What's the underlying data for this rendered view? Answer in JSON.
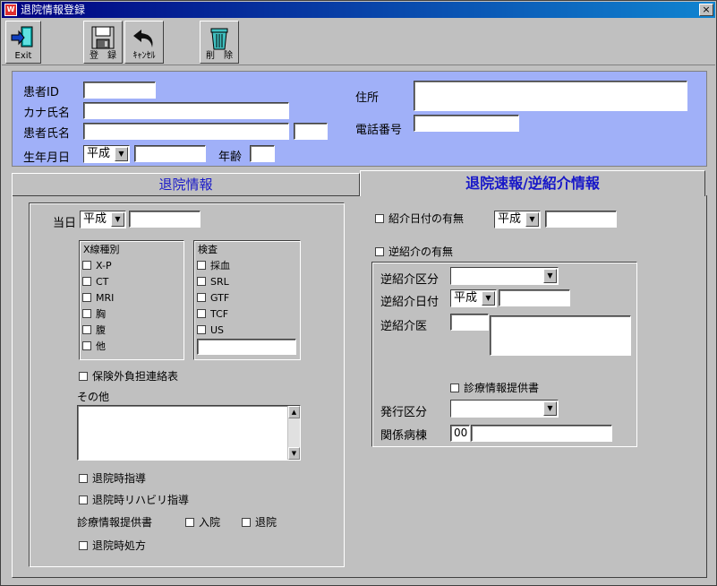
{
  "window": {
    "title": "退院情報登録",
    "icon": "app-icon",
    "close_label": "×"
  },
  "toolbar": {
    "exit": "Exit",
    "register": "登　録",
    "cancel": "ｷｬﾝｾﾙ",
    "delete": "削　除"
  },
  "patient": {
    "id_label": "患者ID",
    "kana_label": "カナ氏名",
    "name_label": "患者氏名",
    "dob_label": "生年月日",
    "era_value": "平成",
    "age_label": "年齢",
    "address_label": "住所",
    "phone_label": "電話番号"
  },
  "tabs": {
    "left": "退院情報",
    "right": "退院速報/逆紹介情報"
  },
  "left": {
    "date_label": "当日",
    "era_value": "平成",
    "xray_title": "X線種別",
    "xray_items": [
      "X-P",
      "CT",
      "MRI",
      "胸",
      "腹",
      "他"
    ],
    "exam_title": "検査",
    "exam_items": [
      "採血",
      "SRL",
      "GTF",
      "TCF",
      "US"
    ],
    "insurance_label": "保険外負担連絡表",
    "other_label": "その他",
    "guidance_label": "退院時指導",
    "rehab_label": "退院時リハビリ指導",
    "provision_label": "診療情報提供書",
    "admit_label": "入院",
    "discharge_label": "退院",
    "prescription_label": "退院時処方"
  },
  "right": {
    "referral_date_label": "紹介日付の有無",
    "era_value": "平成",
    "reverse_label": "逆紹介の有無",
    "category_label": "逆紹介区分",
    "reverse_date_label": "逆紹介日付",
    "reverse_era": "平成",
    "doctor_label": "逆紹介医",
    "provision_label": "診療情報提供書",
    "issue_label": "発行区分",
    "ward_label": "関係病棟",
    "ward_code": "00"
  },
  "colors": {
    "panel": "#c0c0c0",
    "patient_bg": "#a0b0f8",
    "title_bar": "#000080",
    "tab_text": "#1818c8"
  }
}
